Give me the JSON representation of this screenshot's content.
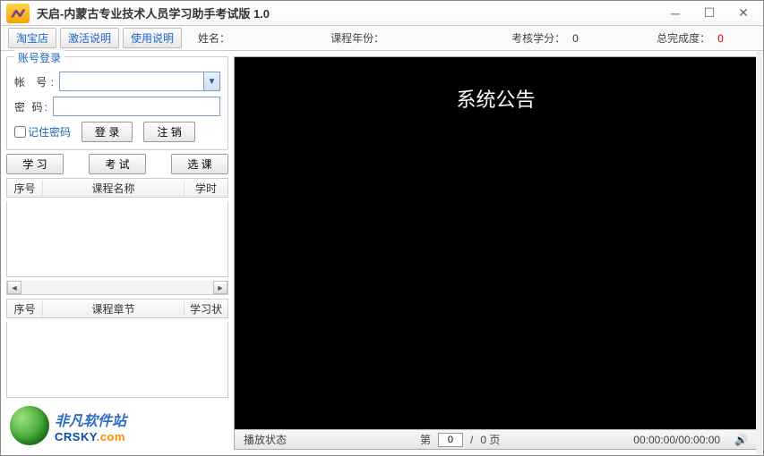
{
  "title": "天启-内蒙古专业技术人员学习助手考试版  1.0",
  "toolbar": {
    "buttons": {
      "taobao": "淘宝店",
      "activate": "激活说明",
      "usage": "使用说明"
    },
    "labels": {
      "name": "姓名：",
      "year": "课程年份：",
      "credits": "考核学分：",
      "progress": "总完成度："
    },
    "values": {
      "name": "",
      "year": "",
      "credits": "0",
      "progress": "0"
    }
  },
  "login": {
    "title": "账号登录",
    "account_label": "帐  号:",
    "password_label": "密  码:",
    "remember": "记住密码",
    "login_btn": "登 录",
    "logout_btn": "注 销"
  },
  "nav": {
    "study": "学 习",
    "exam": "考 试",
    "select": "选 课"
  },
  "list1": {
    "col1": "序号",
    "col2": "课程名称",
    "col3": "学时"
  },
  "list2": {
    "col1": "序号",
    "col2": "课程章节",
    "col3": "学习状"
  },
  "brand": {
    "cn": "非凡软件站",
    "en": "CRSKY",
    "dotcom": ".com"
  },
  "video": {
    "announce": "系统公告"
  },
  "status": {
    "play_state": "播放状态",
    "page_prefix": "第",
    "page_current": "0",
    "page_sep": " / ",
    "page_total": "0 页",
    "time": "00:00:00/00:00:00"
  }
}
